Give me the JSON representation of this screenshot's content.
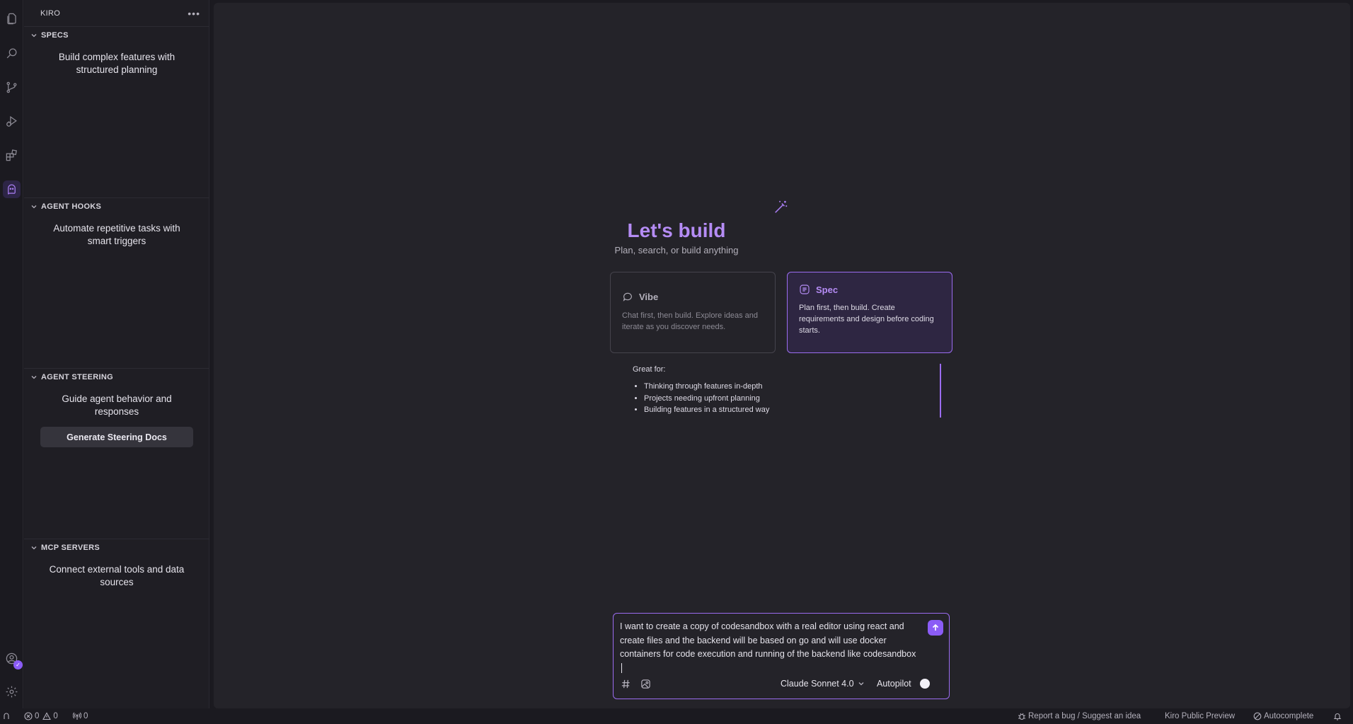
{
  "sidebar": {
    "title": "KIRO",
    "sections": [
      {
        "title": "SPECS",
        "description": "Build complex features with structured planning"
      },
      {
        "title": "AGENT HOOKS",
        "description": "Automate repetitive tasks with smart triggers"
      },
      {
        "title": "AGENT STEERING",
        "description": "Guide agent behavior and responses",
        "button": "Generate Steering Docs"
      },
      {
        "title": "MCP SERVERS",
        "description": "Connect external tools and data sources"
      }
    ]
  },
  "main": {
    "title": "Let's build",
    "subtitle": "Plan, search, or build anything",
    "modes": [
      {
        "name": "Vibe",
        "description": "Chat first, then build. Explore ideas and iterate as you discover needs."
      },
      {
        "name": "Spec",
        "description": "Plan first, then build. Create requirements and design before coding starts."
      }
    ],
    "great_for": {
      "label": "Great for:",
      "items": [
        "Thinking through features in-depth",
        "Projects needing upfront planning",
        "Building features in a structured way"
      ]
    }
  },
  "chat": {
    "input_value": "I want to create a copy of codesandbox with a real editor using react and create files and the backend will be based on go and will use docker containers for code execution and running of the backend like codesandbox",
    "model": "Claude Sonnet 4.0",
    "autopilot_label": "Autopilot"
  },
  "statusbar": {
    "errors": "0",
    "warnings": "0",
    "ports": "0",
    "report": "Report a bug / Suggest an idea",
    "preview": "Kiro Public Preview",
    "autocomplete": "Autocomplete"
  }
}
